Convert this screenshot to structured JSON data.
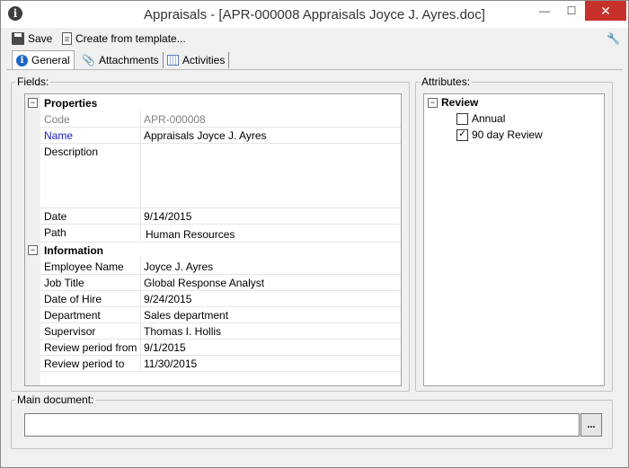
{
  "window": {
    "title": "Appraisals - [APR-000008 Appraisals Joyce J. Ayres.doc]",
    "app_icon": "info-icon"
  },
  "toolbar": {
    "save_label": "Save",
    "create_label": "Create from template..."
  },
  "tabs": [
    {
      "label": "General",
      "icon": "info-icon",
      "active": true
    },
    {
      "label": "Attachments",
      "icon": "paperclip-icon"
    },
    {
      "label": "Activities",
      "icon": "calendar-icon"
    }
  ],
  "fields": {
    "legend": "Fields:",
    "categories": [
      {
        "label": "Properties",
        "rows": [
          {
            "label": "Code",
            "value": "APR-000008"
          },
          {
            "label": "Name",
            "value": "Appraisals Joyce J. Ayres"
          },
          {
            "label": "Description",
            "value": ""
          },
          {
            "label": "Date",
            "value": "9/14/2015"
          },
          {
            "label": "Path",
            "value": "Human Resources"
          }
        ]
      },
      {
        "label": "Information",
        "rows": [
          {
            "label": "Employee Name",
            "value": "Joyce J. Ayres"
          },
          {
            "label": "Job Title",
            "value": "Global Response Analyst"
          },
          {
            "label": "Date of Hire",
            "value": "9/24/2015"
          },
          {
            "label": "Department",
            "value": "Sales department"
          },
          {
            "label": "Supervisor",
            "value": "Thomas I. Hollis"
          },
          {
            "label": "Review period from",
            "value": "9/1/2015"
          },
          {
            "label": "Review period to",
            "value": "11/30/2015"
          }
        ]
      }
    ]
  },
  "attributes": {
    "legend": "Attributes:",
    "group": "Review",
    "items": [
      {
        "label": "Annual",
        "checked": false
      },
      {
        "label": "90 day Review",
        "checked": true
      }
    ]
  },
  "main_document": {
    "legend": "Main document:",
    "value": "",
    "browse_label": "..."
  }
}
